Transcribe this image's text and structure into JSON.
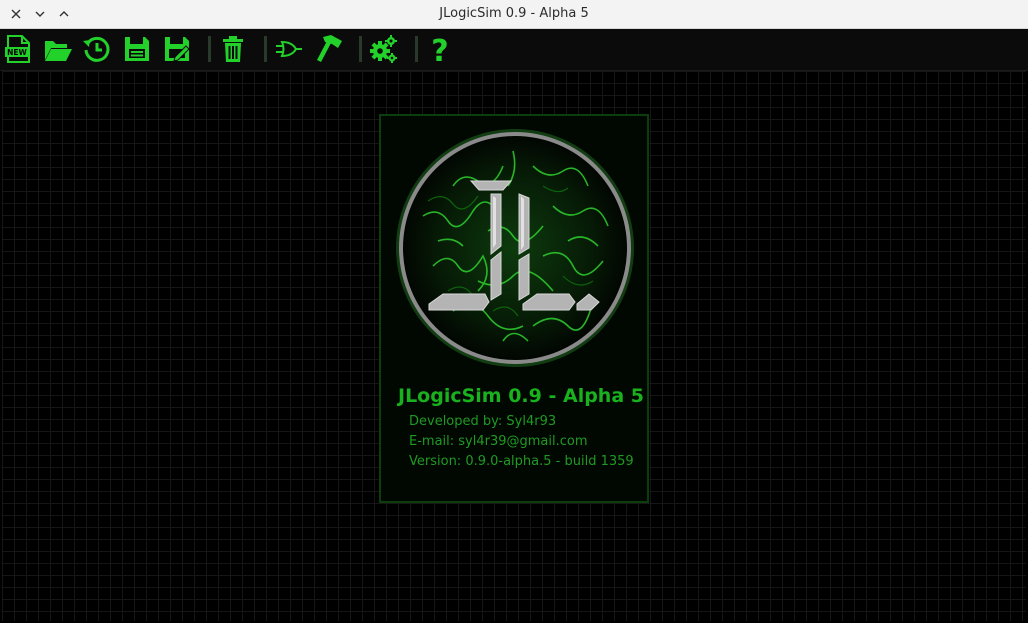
{
  "window": {
    "title": "JLogicSim 0.9 - Alpha 5",
    "controls": [
      "close",
      "minimize",
      "maximize"
    ]
  },
  "toolbar": {
    "accent": "#22d12a",
    "items": [
      {
        "name": "new",
        "icon": "new-file-icon",
        "badge": "NEW"
      },
      {
        "name": "open",
        "icon": "folder-open-icon"
      },
      {
        "name": "recent",
        "icon": "history-icon"
      },
      {
        "name": "save",
        "icon": "save-icon"
      },
      {
        "name": "save-as",
        "icon": "save-as-icon"
      },
      {
        "name": "delete",
        "icon": "trash-icon"
      },
      {
        "name": "gate",
        "icon": "logic-gate-icon"
      },
      {
        "name": "build",
        "icon": "hammer-icon"
      },
      {
        "name": "settings",
        "icon": "gears-icon"
      },
      {
        "name": "help",
        "icon": "help-icon",
        "glyph": "?"
      }
    ]
  },
  "about": {
    "logo_text": "JL",
    "title": "JLogicSim 0.9 - Alpha 5",
    "developer": "Developed by: Syl4r93",
    "email": "E-mail: syl4r39@gmail.com",
    "version": "Version: 0.9.0-alpha.5 - build 1359"
  },
  "colors": {
    "canvas_bg": "#000000",
    "grid": "#161616",
    "accent_green": "#22d12a",
    "text_green": "#1f9a22"
  }
}
